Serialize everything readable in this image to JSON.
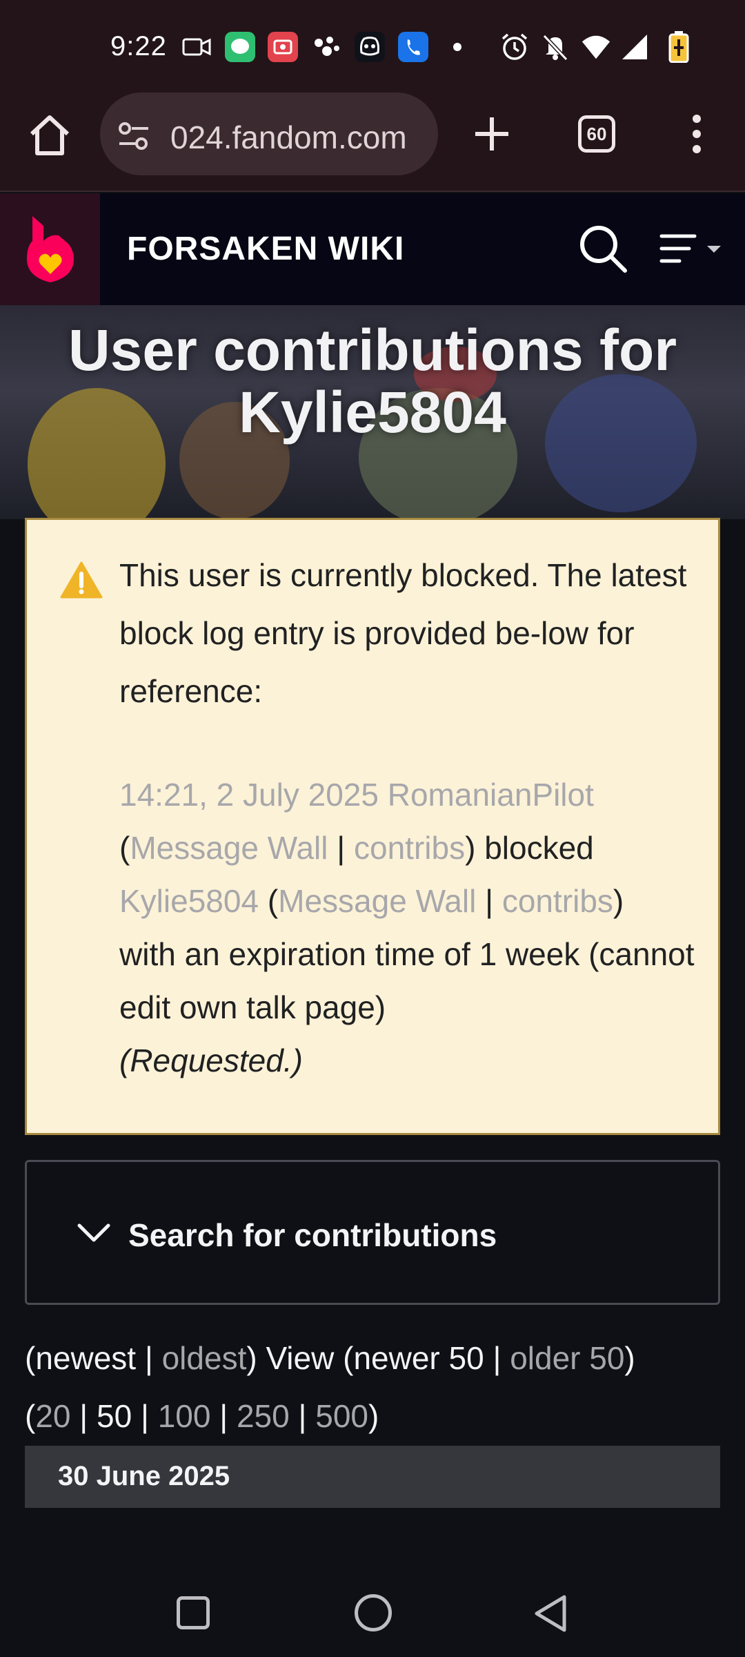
{
  "status_bar": {
    "time": "9:22",
    "icons": [
      "video-icon",
      "messages-icon",
      "screen-record-icon",
      "assistant-icon",
      "discord-icon",
      "phone-icon",
      "dot-icon",
      "alarm-icon",
      "mute-icon",
      "wifi-icon",
      "signal-icon",
      "battery-icon"
    ]
  },
  "browser": {
    "url": "024.fandom.com",
    "tab_count": "60"
  },
  "fandom": {
    "wiki_title": "FORSAKEN WIKI"
  },
  "page": {
    "title_line1": "User contributions for",
    "title_line2": "Kylie5804"
  },
  "block_notice": {
    "message": "This user is currently blocked. The latest block log entry is provided be-low for reference:",
    "log": {
      "timestamp": "14:21, 2 July 2025",
      "blocker": "RomanianPilot",
      "message_wall_1": "Message Wall",
      "contribs_1": "contribs",
      "blocked_word": "blocked",
      "target": "Kylie5804",
      "message_wall_2": "Message Wall",
      "contribs_2": "contribs",
      "details": "with an expiration time of 1 week (cannot edit own talk page)",
      "reason": "(Requested.)"
    }
  },
  "search_panel": {
    "label": "Search for contributions"
  },
  "pager": {
    "newest": "newest",
    "oldest": "oldest",
    "view": "View",
    "newer": "newer 50",
    "older": "older 50",
    "limits": [
      "20",
      "50",
      "100",
      "250",
      "500"
    ]
  },
  "date_group": {
    "label": "30 June 2025"
  },
  "colors": {
    "warning_bg": "#fcf2d7",
    "warning_icon": "#f0b429",
    "link_muted": "#a7a7ab",
    "fandom_pink": "#fa005a"
  }
}
